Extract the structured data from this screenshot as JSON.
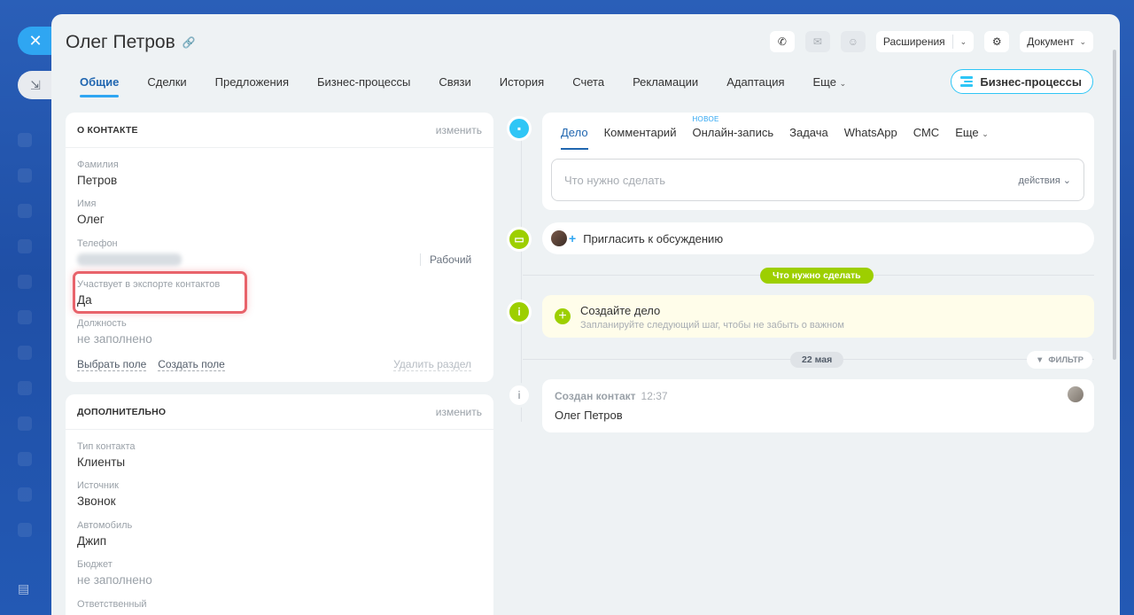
{
  "window": {
    "title": "Олег Петров"
  },
  "header": {
    "extensions_label": "Расширения",
    "document_label": "Документ"
  },
  "tabs": [
    {
      "label": "Общие",
      "active": true
    },
    {
      "label": "Сделки"
    },
    {
      "label": "Предложения"
    },
    {
      "label": "Бизнес-процессы"
    },
    {
      "label": "Связи"
    },
    {
      "label": "История"
    },
    {
      "label": "Счета"
    },
    {
      "label": "Рекламации"
    },
    {
      "label": "Адаптация"
    },
    {
      "label": "Еще"
    }
  ],
  "bp_button_label": "Бизнес-процессы",
  "about": {
    "title": "О контакте",
    "edit": "изменить",
    "fields": [
      {
        "label": "Фамилия",
        "value": "Петров"
      },
      {
        "label": "Имя",
        "value": "Олег"
      },
      {
        "label": "Телефон",
        "value": "",
        "type": "Рабочий"
      },
      {
        "label": "Участвует в экспорте контактов",
        "value": "Да"
      },
      {
        "label": "Должность",
        "value": "не заполнено"
      }
    ],
    "links": {
      "select_field": "Выбрать поле",
      "create_field": "Создать поле",
      "delete_section": "Удалить раздел"
    }
  },
  "additional": {
    "title": "Дополнительно",
    "edit": "изменить",
    "fields": [
      {
        "label": "Тип контакта",
        "value": "Клиенты"
      },
      {
        "label": "Источник",
        "value": "Звонок"
      },
      {
        "label": "Автомобиль",
        "value": "Джип"
      },
      {
        "label": "Бюджет",
        "value": "не заполнено"
      },
      {
        "label": "Ответственный",
        "value": ""
      }
    ]
  },
  "editor": {
    "tabs": [
      {
        "label": "Дело",
        "active": true
      },
      {
        "label": "Комментарий"
      },
      {
        "label": "Онлайн-запись",
        "badge": "НОВОЕ"
      },
      {
        "label": "Задача"
      },
      {
        "label": "WhatsApp"
      },
      {
        "label": "СМС"
      },
      {
        "label": "Еще"
      }
    ],
    "placeholder": "Что нужно сделать",
    "actions_label": "действия"
  },
  "invite_label": "Пригласить к обсуждению",
  "todo_pill": "Что нужно сделать",
  "create": {
    "title": "Создайте дело",
    "subtitle": "Запланируйте следующий шаг, чтобы не забыть о важном"
  },
  "date_pill": "22 мая",
  "filter_label": "ФИЛЬТР",
  "created": {
    "title": "Создан контакт",
    "time": "12:37",
    "name": "Олег Петров"
  },
  "colors": {
    "accent": "#2fa6f2",
    "green": "#9dcf00",
    "highlight": "#e8636b"
  }
}
